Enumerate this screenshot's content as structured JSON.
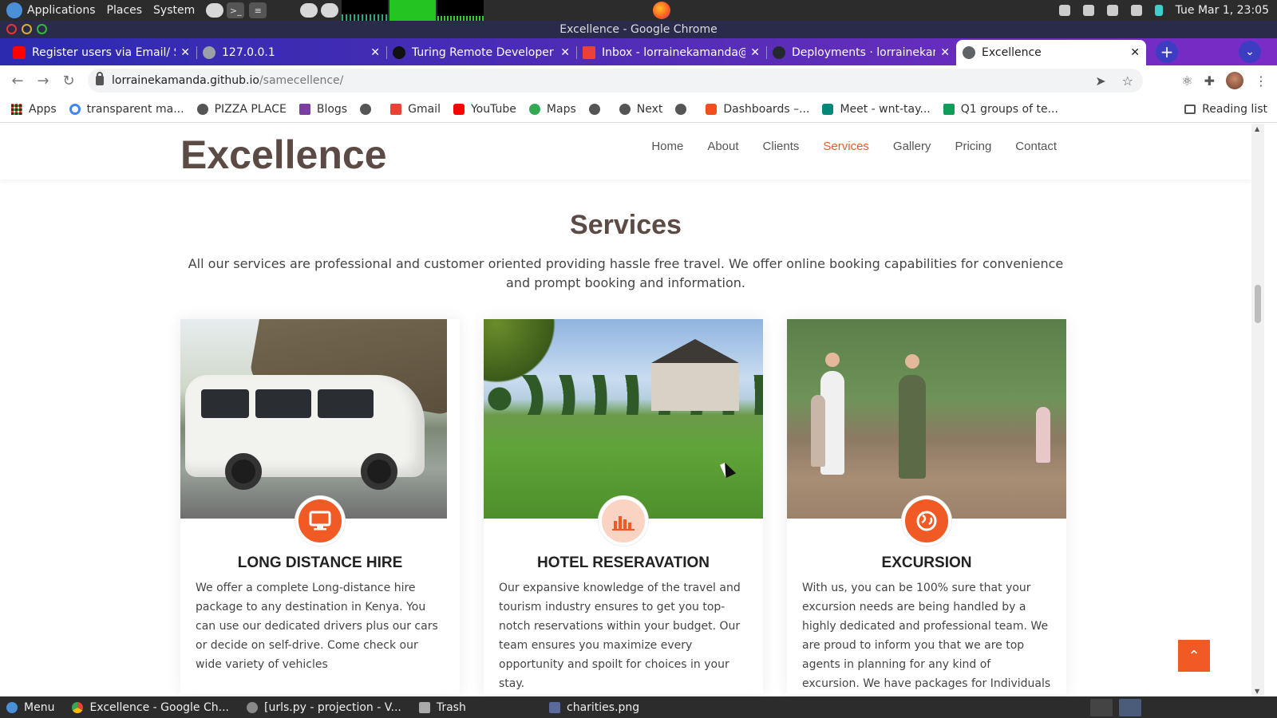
{
  "os_top": {
    "menus": [
      "Applications",
      "Places",
      "System"
    ],
    "clock": "Tue Mar 1, 23:05"
  },
  "window": {
    "title": "Excellence - Google Chrome"
  },
  "tabs": [
    {
      "title": "Register users via Email/ S",
      "favicon_color": "#ff0000"
    },
    {
      "title": "127.0.0.1",
      "favicon_color": "#9aa0a6"
    },
    {
      "title": "Turing Remote Developer",
      "favicon_color": "#111111"
    },
    {
      "title": "Inbox - lorrainekamanda@",
      "favicon_color": "#ea4335"
    },
    {
      "title": "Deployments · lorrainekam",
      "favicon_color": "#24292e"
    },
    {
      "title": "Excellence",
      "favicon_color": "#5f6368"
    }
  ],
  "address_bar": {
    "host": "lorrainekamanda.github.io",
    "path": "/samecellence/"
  },
  "bookmarks": [
    {
      "label": "Apps"
    },
    {
      "label": "transparent ma..."
    },
    {
      "label": "PIZZA PLACE"
    },
    {
      "label": "Blogs"
    },
    {
      "label": ""
    },
    {
      "label": "Gmail"
    },
    {
      "label": "YouTube"
    },
    {
      "label": "Maps"
    },
    {
      "label": ""
    },
    {
      "label": "Next"
    },
    {
      "label": ""
    },
    {
      "label": "Dashboards –..."
    },
    {
      "label": "Meet - wnt-tay..."
    },
    {
      "label": "Q1 groups of te..."
    }
  ],
  "reading_list": "Reading list",
  "site": {
    "brand": "Excellence",
    "nav": [
      "Home",
      "About",
      "Clients",
      "Services",
      "Gallery",
      "Pricing",
      "Contact"
    ],
    "active_nav": "Services",
    "accent_color": "#f15a24"
  },
  "services": {
    "title": "Services",
    "description": "All our services are professional and customer oriented providing hassle free travel. We offer online booking capabilities for convenience and prompt booking and information.",
    "cards": [
      {
        "title": "LONG DISTANCE HIRE",
        "icon": "monitor-icon",
        "text": "We offer a complete Long-distance hire package to any destination in Kenya. You can use our dedicated drivers plus our cars or decide on self-drive. Come check our wide variety of vehicles"
      },
      {
        "title": "HOTEL RESERAVATION",
        "icon": "bar-chart-icon",
        "text": "Our expansive knowledge of the travel and tourism industry ensures to get you top-notch reservations within your budget. Our team ensures you maximize every opportunity and spoilt for choices in your stay."
      },
      {
        "title": "EXCURSION",
        "icon": "globe-icon",
        "text": "With us, you can be 100% sure that your excursion needs are being handled by a highly dedicated and professional team. We are proud to inform you that we are top agents in planning for any kind of excursion. We have packages for Individuals & Groups."
      }
    ]
  },
  "taskbar": [
    {
      "label": "Menu"
    },
    {
      "label": "Excellence - Google Ch..."
    },
    {
      "label": "[urls.py - projection - V..."
    },
    {
      "label": "Trash"
    },
    {
      "label": "charities.png"
    }
  ]
}
